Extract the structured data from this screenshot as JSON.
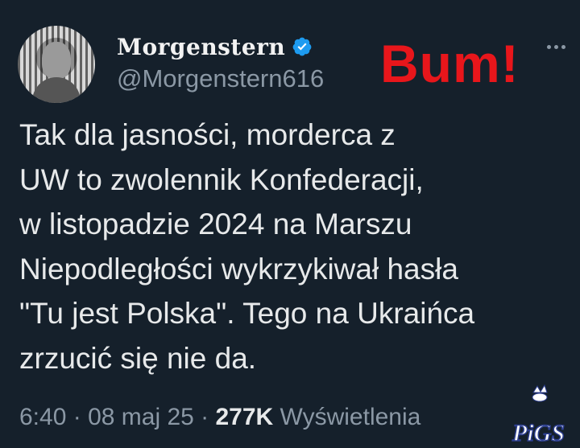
{
  "author": {
    "display_name": "Morgenstern",
    "handle": "@Morgenstern616"
  },
  "overlay_text": "Bum!",
  "tweet": {
    "lines": [
      "Tak dla jasności, morderca z",
      "UW to zwolennik Konfederacji,",
      "w listopadzie 2024 na Marszu",
      "Niepodległości wykrzykiwał hasła",
      "\"Tu jest Polska\". Tego na Ukraińca",
      "zrzucić się nie da."
    ]
  },
  "meta": {
    "time": "6:40",
    "separator": " · ",
    "date": "08 maj 25",
    "views": "277K",
    "views_label": "Wyświetlenia"
  },
  "watermark": {
    "text": "PiGS"
  },
  "colors": {
    "background": "#15202b",
    "text": "#e7e9ea",
    "secondary": "#8b98a5",
    "verified": "#1d9bf0",
    "overlay": "#e8161b"
  },
  "icons": [
    "verified-badge-icon",
    "more-options-icon"
  ]
}
